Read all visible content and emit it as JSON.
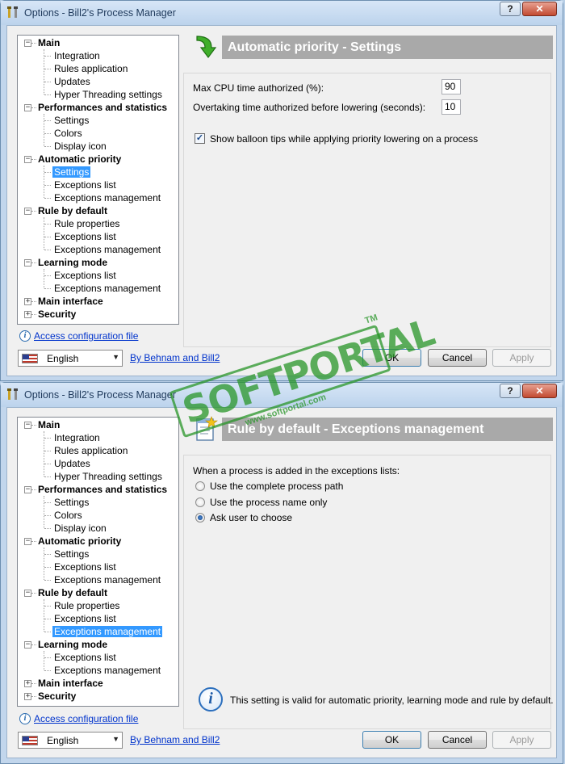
{
  "colors": {
    "selection": "#3399ff",
    "header_bar": "#a9a9a9",
    "link": "#0033cc",
    "watermark": "#28962a"
  },
  "icons": [
    "app-tools-icon",
    "help-icon",
    "close-icon",
    "green-arrow-icon",
    "rule-document-icon",
    "info-icon",
    "us-flag-icon",
    "dropdown-arrow-icon"
  ],
  "tree": {
    "categories": [
      {
        "label": "Main",
        "expanded": true,
        "children": [
          "Integration",
          "Rules application",
          "Updates",
          "Hyper Threading settings"
        ]
      },
      {
        "label": "Performances and statistics",
        "expanded": true,
        "children": [
          "Settings",
          "Colors",
          "Display icon"
        ]
      },
      {
        "label": "Automatic priority",
        "expanded": true,
        "children": [
          "Settings",
          "Exceptions list",
          "Exceptions management"
        ]
      },
      {
        "label": "Rule by default",
        "expanded": true,
        "children": [
          "Rule properties",
          "Exceptions list",
          "Exceptions management"
        ]
      },
      {
        "label": "Learning mode",
        "expanded": true,
        "children": [
          "Exceptions list",
          "Exceptions management"
        ]
      },
      {
        "label": "Main interface",
        "expanded": false,
        "children": []
      },
      {
        "label": "Security",
        "expanded": false,
        "children": []
      }
    ]
  },
  "footer": {
    "config_link": "Access configuration file",
    "language": "English",
    "author_link": "By Behnam and Bill2",
    "ok": "OK",
    "cancel": "Cancel",
    "apply": "Apply"
  },
  "window1": {
    "title": "Options - Bill2's Process Manager",
    "selected": "Automatic priority/Settings",
    "header": "Automatic priority - Settings",
    "fields": [
      {
        "label": "Max CPU time authorized (%):",
        "value": "90"
      },
      {
        "label": "Overtaking time authorized before lowering (seconds):",
        "value": "10"
      }
    ],
    "checkbox": {
      "label": "Show balloon tips while applying priority lowering on a process",
      "checked": true
    }
  },
  "window2": {
    "title": "Options - Bill2's Process Manager",
    "selected": "Rule by default/Exceptions management",
    "header": "Rule by default - Exceptions management",
    "prompt": "When a process is added in the exceptions lists:",
    "radios": [
      {
        "label": "Use the complete process path",
        "checked": false
      },
      {
        "label": "Use the process name only",
        "checked": false
      },
      {
        "label": "Ask user to choose",
        "checked": true
      }
    ],
    "info": "This setting is valid for automatic priority, learning mode and rule by default."
  },
  "watermark": {
    "brand": "SOFTPORTAL",
    "tm": "TM",
    "url": "www.softportal.com"
  }
}
